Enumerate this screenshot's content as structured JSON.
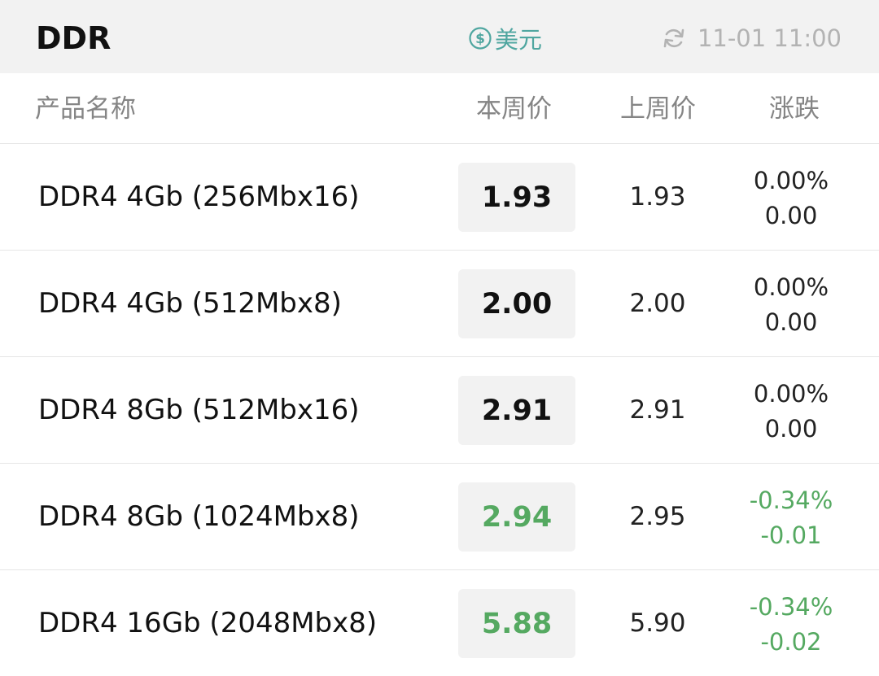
{
  "header": {
    "title": "DDR",
    "currency_label": "美元",
    "currency_icon": "dollar-circle-icon",
    "updated_time": "11-01 11:00",
    "refresh_icon": "refresh-icon"
  },
  "columns": {
    "name": "产品名称",
    "current": "本周价",
    "previous": "上周价",
    "change": "涨跌"
  },
  "colors": {
    "accent": "#4fa6a0",
    "down": "#55a961",
    "header_bg": "#f2f2f2"
  },
  "rows": [
    {
      "name": "DDR4 4Gb (256Mbx16)",
      "current": "1.93",
      "previous": "1.93",
      "change_pct": "0.00%",
      "change_abs": "0.00",
      "trend": "flat"
    },
    {
      "name": "DDR4 4Gb (512Mbx8)",
      "current": "2.00",
      "previous": "2.00",
      "change_pct": "0.00%",
      "change_abs": "0.00",
      "trend": "flat"
    },
    {
      "name": "DDR4 8Gb (512Mbx16)",
      "current": "2.91",
      "previous": "2.91",
      "change_pct": "0.00%",
      "change_abs": "0.00",
      "trend": "flat"
    },
    {
      "name": "DDR4 8Gb (1024Mbx8)",
      "current": "2.94",
      "previous": "2.95",
      "change_pct": "-0.34%",
      "change_abs": "-0.01",
      "trend": "down"
    },
    {
      "name": "DDR4 16Gb (2048Mbx8)",
      "current": "5.88",
      "previous": "5.90",
      "change_pct": "-0.34%",
      "change_abs": "-0.02",
      "trend": "down"
    }
  ]
}
